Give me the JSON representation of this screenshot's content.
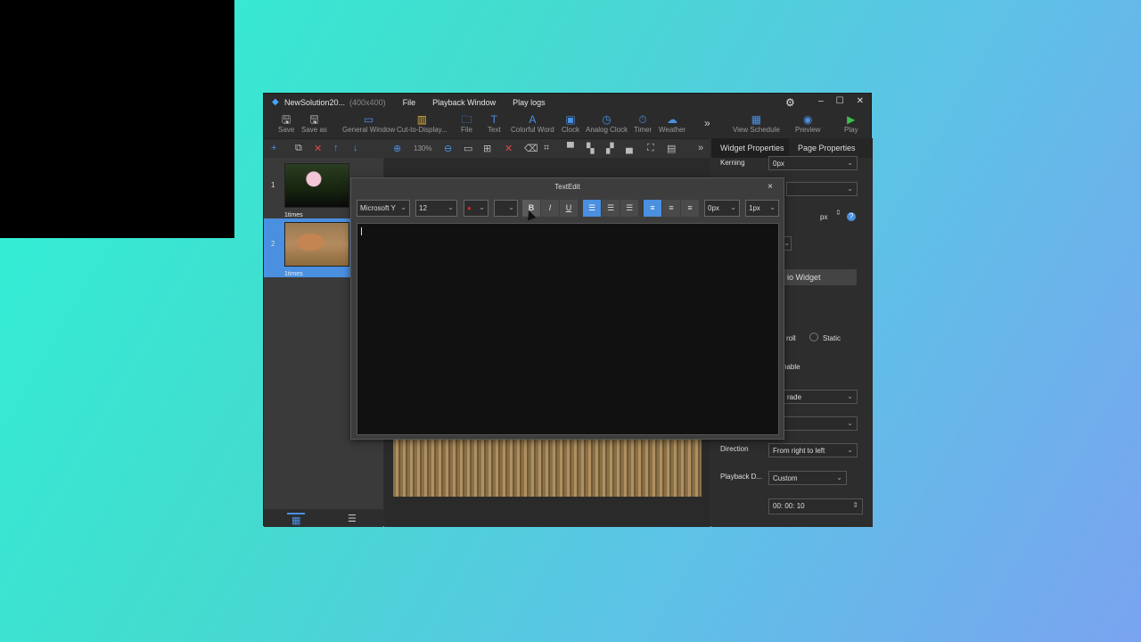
{
  "window": {
    "title": "NewSolution20...",
    "dims": "(400x400)",
    "menu": [
      "File",
      "Playback Window",
      "Play logs"
    ],
    "controls": {
      "settings": "⚙",
      "minimize": "–",
      "maximize": "☐",
      "close": "✕"
    }
  },
  "toolbar": {
    "save": "Save",
    "save_as": "Save as",
    "general_window": "General Window",
    "cut_to_display": "Cut-to-Display...",
    "file": "File",
    "text": "Text",
    "colorful_word": "Colorful Word",
    "clock": "Clock",
    "analog_clock": "Analog Clock",
    "timer": "Timer",
    "weather": "Weather",
    "more": "»",
    "view_schedule": "View Schedule",
    "preview": "Preview",
    "play": "Play"
  },
  "subbar": {
    "zoom": "130%"
  },
  "tabs": {
    "widget": "Widget Properties",
    "page": "Page Properties"
  },
  "pages": [
    {
      "num": "1",
      "caption": "1times"
    },
    {
      "num": "2",
      "caption": "1times"
    }
  ],
  "right_panel": {
    "kerning_label": "Kerning",
    "kerning_value": "0px",
    "px_unit": "px",
    "help": "?",
    "widget_btn": "io Widget",
    "scroll_label": "roll",
    "static_label": "Static",
    "enable_label": "nable",
    "grade_value": "rade",
    "direction_label": "Direction",
    "direction_value": "From right to left",
    "playback_label": "Playback D...",
    "playback_value": "Custom",
    "time_value": "00: 00: 10"
  },
  "dialog": {
    "title": "TextEdit",
    "close": "×",
    "font": "Microsoft Y",
    "size": "12",
    "bold": "B",
    "italic": "I",
    "underline": "U",
    "letter_spacing": "0px",
    "line_spacing": "1px"
  }
}
